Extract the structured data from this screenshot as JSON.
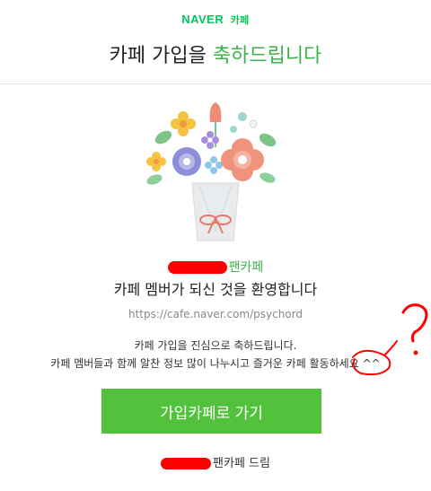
{
  "brand": {
    "naver": "NAVER",
    "cafe": "카페"
  },
  "headline": {
    "prefix": "카페 가입을 ",
    "accent": "축하드립니다"
  },
  "cafe": {
    "name_suffix": "팬카페",
    "welcome": "카페 멤버가 되신 것을 환영합니다",
    "url": "https://cafe.naver.com/psychord"
  },
  "message": {
    "line1": "카페 가입을 진심으로 축하드립니다.",
    "line2": "카페 멤버들과 함께 알찬 정보 많이 나누시고 즐거운 카페 활동하세요 ^^"
  },
  "button": {
    "label": "가입카페로 가기"
  },
  "signature": {
    "suffix": "팬카페 드림"
  },
  "annotation": {
    "text": "?"
  },
  "colors": {
    "accent": "#3eb24a",
    "button": "#52c23d",
    "brand": "#03c75a",
    "annotation": "#ff0000"
  },
  "icons": {
    "bouquet": "flower-bouquet-illustration"
  }
}
